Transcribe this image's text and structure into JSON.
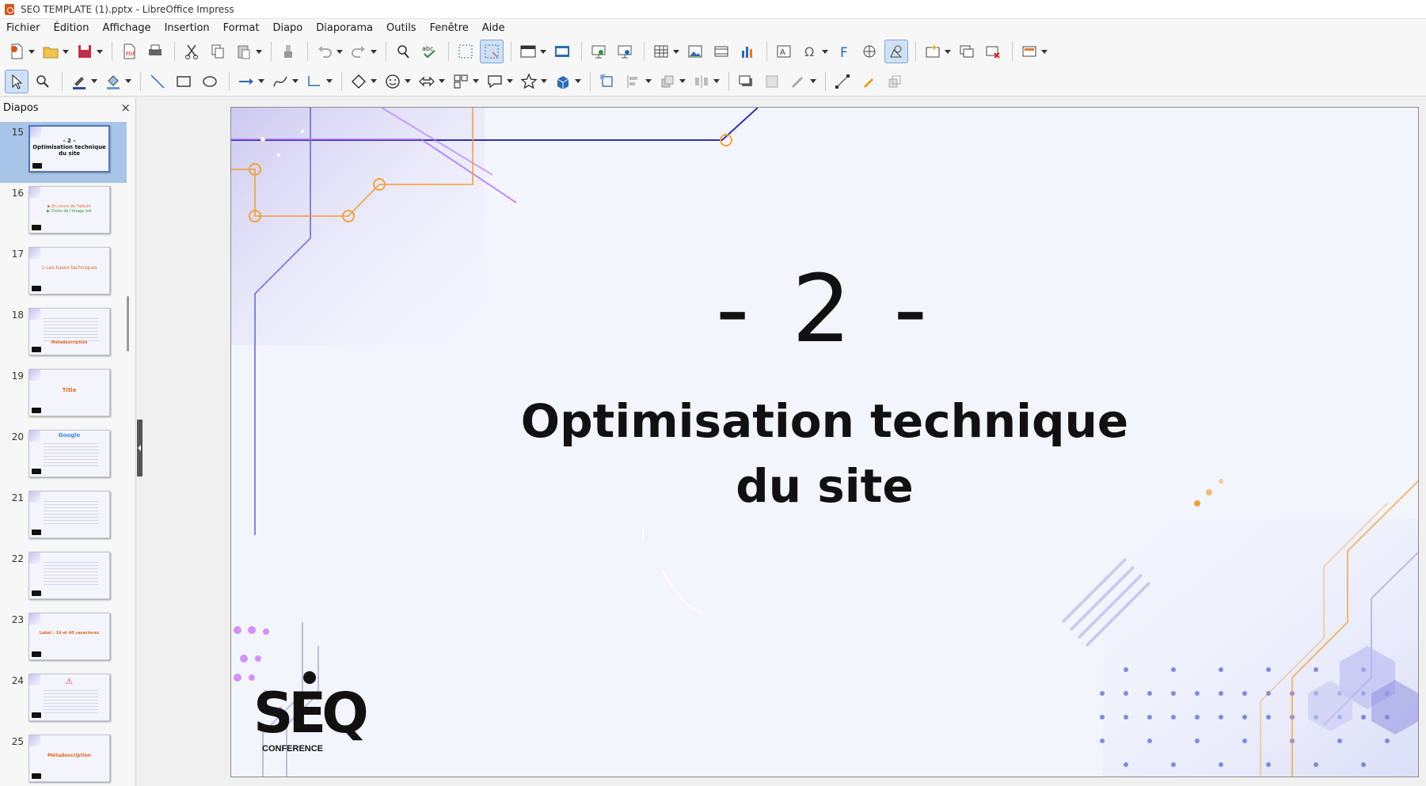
{
  "window": {
    "title": "SEO TEMPLATE (1).pptx - LibreOffice Impress"
  },
  "menu": [
    "Fichier",
    "Édition",
    "Affichage",
    "Insertion",
    "Format",
    "Diapo",
    "Diaporama",
    "Outils",
    "Fenêtre",
    "Aide"
  ],
  "sidebar": {
    "title": "Diapos",
    "close_label": "×",
    "slides": [
      {
        "number": "15",
        "thumb_text": "- 2 -\nOptimisation technique du site",
        "selected": true
      },
      {
        "number": "16",
        "thumb_text": "▶ En cours de l'album",
        "selected": false
      },
      {
        "number": "17",
        "thumb_text": "1-Les bases techniques",
        "selected": false
      },
      {
        "number": "18",
        "thumb_text": "Métadescription",
        "selected": false
      },
      {
        "number": "19",
        "thumb_text": "Title",
        "selected": false
      },
      {
        "number": "20",
        "thumb_text": "Google",
        "selected": false
      },
      {
        "number": "21",
        "thumb_text": "",
        "selected": false
      },
      {
        "number": "22",
        "thumb_text": "",
        "selected": false
      },
      {
        "number": "23",
        "thumb_text": "Label : 14 et 40 caractères",
        "selected": false
      },
      {
        "number": "24",
        "thumb_text": "",
        "selected": false
      },
      {
        "number": "25",
        "thumb_text": "Métadescription",
        "selected": false
      }
    ]
  },
  "slide": {
    "number_text": "- 2 -",
    "title_line1": "Optimisation technique",
    "title_line2": "du site",
    "logo_letters": "SEQ",
    "logo_sub": "CONFERENCE"
  },
  "colors": {
    "accent_blue": "#4a78c0",
    "slide_bg": "#f3f5fd",
    "orange": "#f0a040",
    "purple": "#b070f0",
    "navy": "#3030b0"
  }
}
